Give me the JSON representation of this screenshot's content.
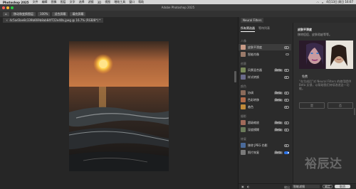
{
  "menubar": {
    "app": "Photoshop 2025",
    "items": [
      "文件",
      "编辑",
      "图像",
      "图层",
      "文字",
      "选择",
      "滤镜",
      "3D",
      "视图",
      "增效工具",
      "窗口",
      "帮助"
    ],
    "right": [
      "4月13日 周日 16:07"
    ]
  },
  "window": {
    "title": "Adobe Photoshop 2025"
  },
  "options": {
    "buttons": [
      "移动和变换图层",
      "100%",
      "适合屏幕",
      "填充屏幕"
    ]
  },
  "document": {
    "tab": "4c5ad3ae8c339b669b8ab84f722e40b.jpeg @ 16.7% (RGB/8*) *"
  },
  "panel": {
    "title": "Neural Filters",
    "tabs": [
      "所有筛选器",
      "等待列表"
    ],
    "categories": [
      "人像",
      "创意",
      "颜色",
      "摄影",
      "修复"
    ],
    "filters": [
      {
        "label": "皮肤平滑度",
        "beta": ""
      },
      {
        "label": "智能肖像",
        "beta": ""
      },
      {
        "label": "风景混合器",
        "beta": "Beta"
      },
      {
        "label": "样式转换",
        "beta": ""
      },
      {
        "label": "协调",
        "beta": "Beta"
      },
      {
        "label": "色彩转移",
        "beta": "Beta"
      },
      {
        "label": "着色",
        "beta": ""
      },
      {
        "label": "超级缩放",
        "beta": "Beta"
      },
      {
        "label": "深度模糊",
        "beta": "Beta"
      },
      {
        "label": "移除 JPEG 伪影",
        "beta": ""
      },
      {
        "label": "照片恢复",
        "beta": "Beta"
      }
    ],
    "detail": {
      "title": "皮肤平滑度",
      "desc": "移除痘痘、皮肤瑕疵等等。",
      "note_title": "免费",
      "note_body": "“在生成后”对 Neural Filters 的使用提供 Beta 反馈，以帮助我们持续改进这一功能。",
      "btn_yes": "是",
      "btn_no": "否"
    },
    "footer": {
      "output_label": "输出",
      "output_value": "智能滤镜",
      "ok": "确定",
      "cancel": "取消"
    }
  },
  "watermark": "裕辰达"
}
